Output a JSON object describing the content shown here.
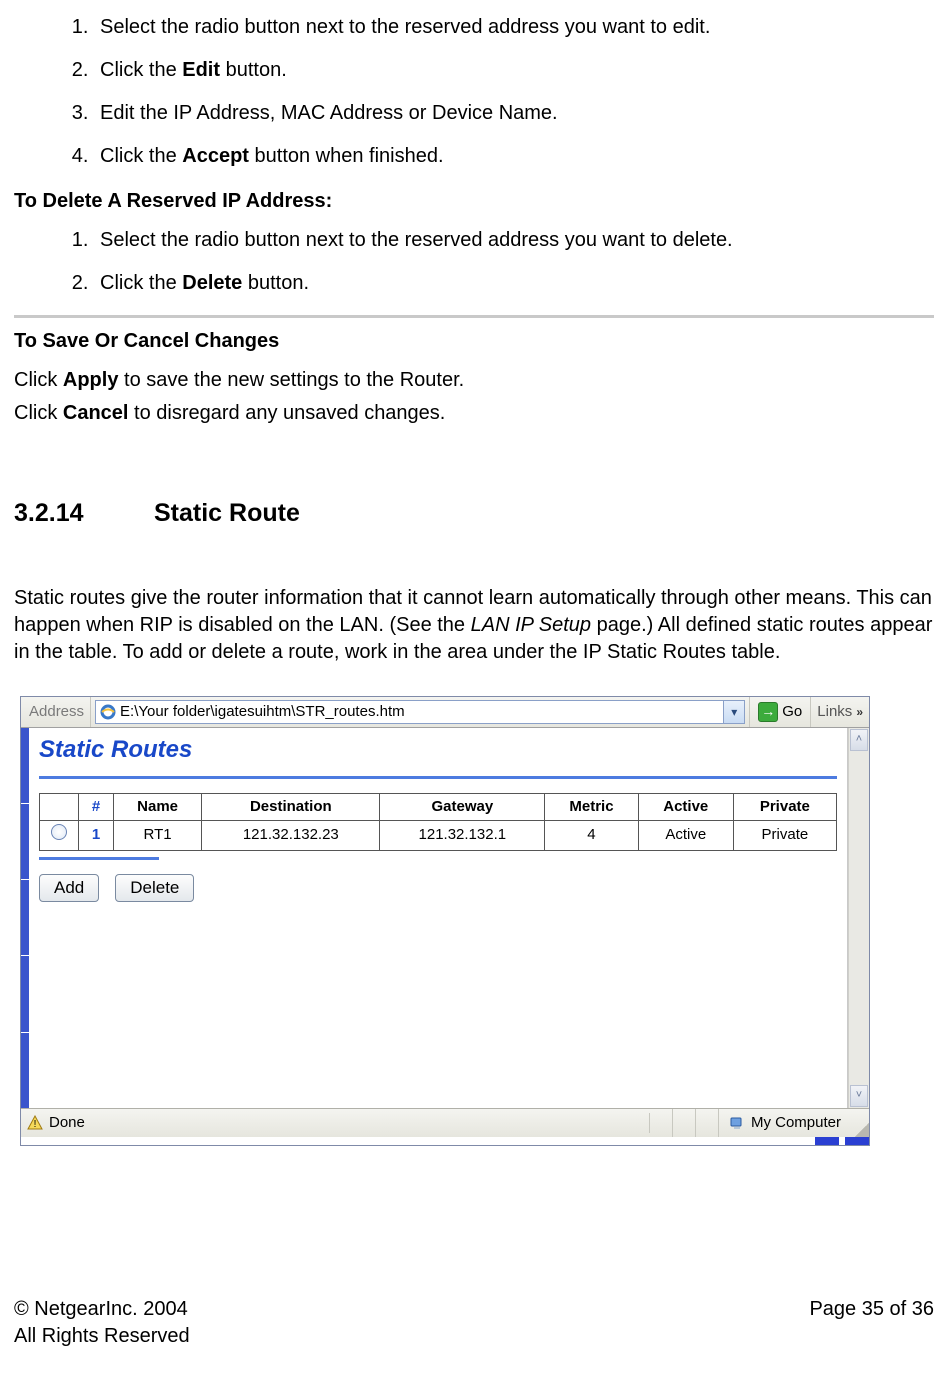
{
  "edit_steps": [
    "Select the radio button next to the reserved address you want to edit.",
    {
      "pre": "Click the ",
      "bold": "Edit",
      "post": " button."
    },
    "Edit the IP Address, MAC Address or Device Name.",
    {
      "pre": "Click the ",
      "bold": "Accept",
      "post": " button when finished."
    }
  ],
  "delete_heading": "To Delete A Reserved IP Address:",
  "delete_steps": [
    "Select the radio button next to the reserved address you want to delete.",
    {
      "pre": "Click the ",
      "bold": "Delete",
      "post": " button."
    }
  ],
  "save_heading": "To Save Or Cancel Changes",
  "save_line1": {
    "pre": "Click ",
    "bold": "Apply",
    "post": " to save the new settings to the Router."
  },
  "save_line2": {
    "pre": "Click ",
    "bold": "Cancel",
    "post": " to disregard any unsaved changes."
  },
  "section": {
    "num": "3.2.14",
    "title": "Static Route"
  },
  "body": {
    "pre": "Static routes give the router information that it cannot learn automatically through other means. This can happen when RIP is disabled on the LAN. (See the ",
    "italic": "LAN IP Setup",
    "post": " page.) All defined static routes appear in the table. To add or delete a route, work in the area under the IP Static Routes table."
  },
  "browser": {
    "address_label": "Address",
    "url": "E:\\Your folder\\igatesuihtm\\STR_routes.htm",
    "go": "Go",
    "links": "Links",
    "done": "Done",
    "zone": "My Computer"
  },
  "page": {
    "title": "Static Routes",
    "headers": [
      "#",
      "Name",
      "Destination",
      "Gateway",
      "Metric",
      "Active",
      "Private"
    ],
    "row": {
      "idx": "1",
      "name": "RT1",
      "dest": "121.32.132.23",
      "gw": "121.32.132.1",
      "metric": "4",
      "active": "Active",
      "private": "Private"
    },
    "add": "Add",
    "delete": "Delete"
  },
  "footer": {
    "copy": "© NetgearInc. 2004",
    "rights": "All Rights Reserved",
    "page": "Page 35 of 36"
  }
}
